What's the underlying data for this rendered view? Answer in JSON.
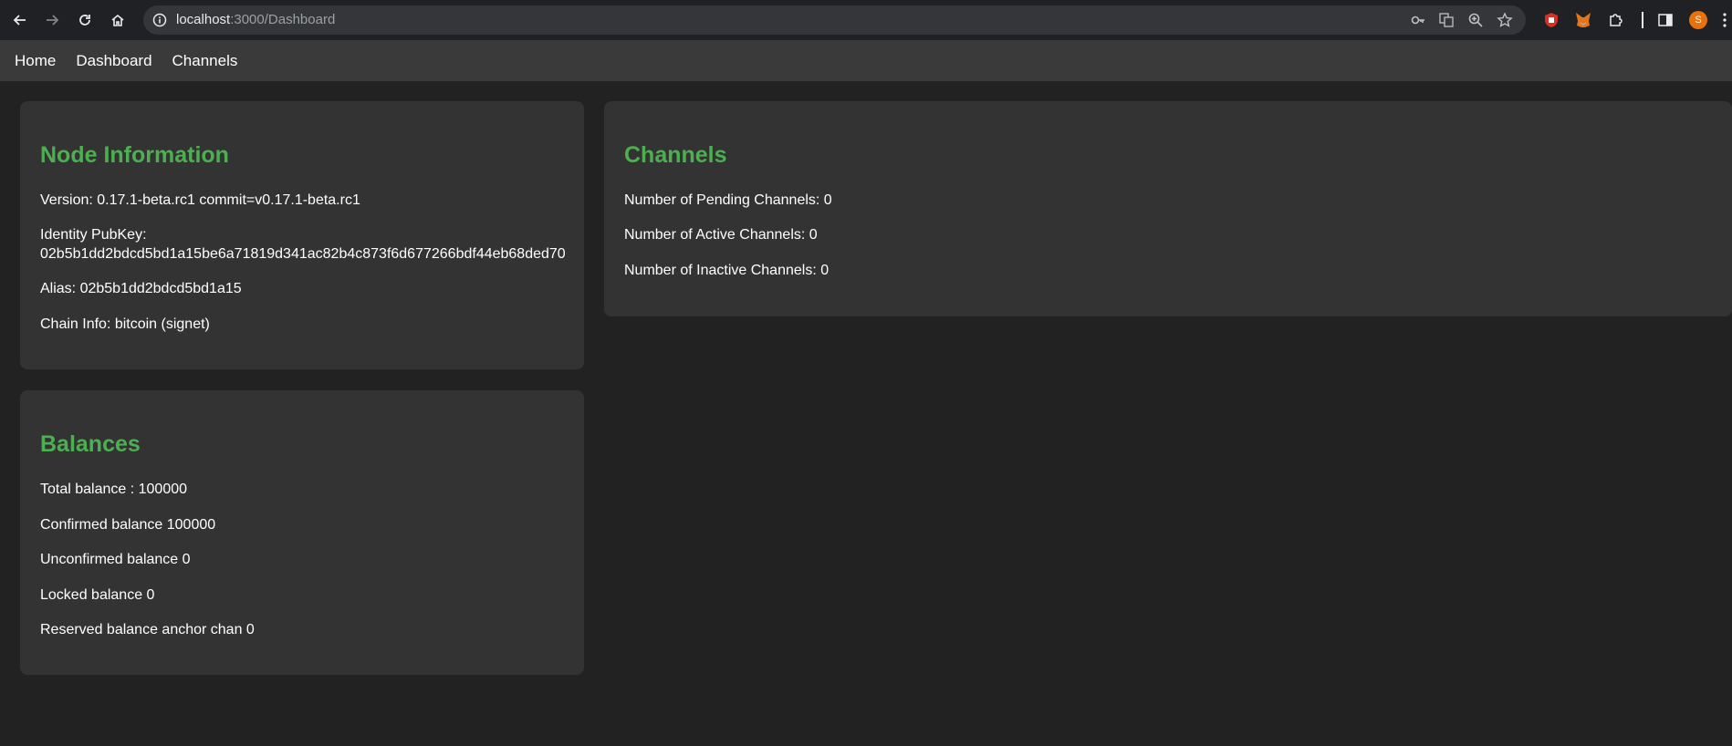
{
  "browser": {
    "url_host": "localhost",
    "url_path": ":3000/Dashboard",
    "avatar_letter": "S"
  },
  "nav": {
    "items": [
      {
        "label": "Home"
      },
      {
        "label": "Dashboard"
      },
      {
        "label": "Channels"
      }
    ]
  },
  "node_info": {
    "title": "Node Information",
    "version": "Version: 0.17.1-beta.rc1 commit=v0.17.1-beta.rc1",
    "pubkey_label": "Identity PubKey:",
    "pubkey_value": "02b5b1dd2bdcd5bd1a15be6a71819d341ac82b4c873f6d677266bdf44eb68ded70",
    "alias": "Alias: 02b5b1dd2bdcd5bd1a15",
    "chain": "Chain Info: bitcoin (signet)"
  },
  "balances": {
    "title": "Balances",
    "total": "Total balance : 100000",
    "confirmed": "Confirmed balance 100000",
    "unconfirmed": "Unconfirmed balance 0",
    "locked": "Locked balance 0",
    "reserved": "Reserved balance anchor chan 0"
  },
  "channels": {
    "title": "Channels",
    "pending": "Number of Pending Channels: 0",
    "active": "Number of Active Channels: 0",
    "inactive": "Number of Inactive Channels: 0"
  },
  "colors": {
    "accent": "#4caf50",
    "card_bg": "#333333",
    "page_bg": "#222222",
    "nav_bg": "#3a3a3a"
  }
}
